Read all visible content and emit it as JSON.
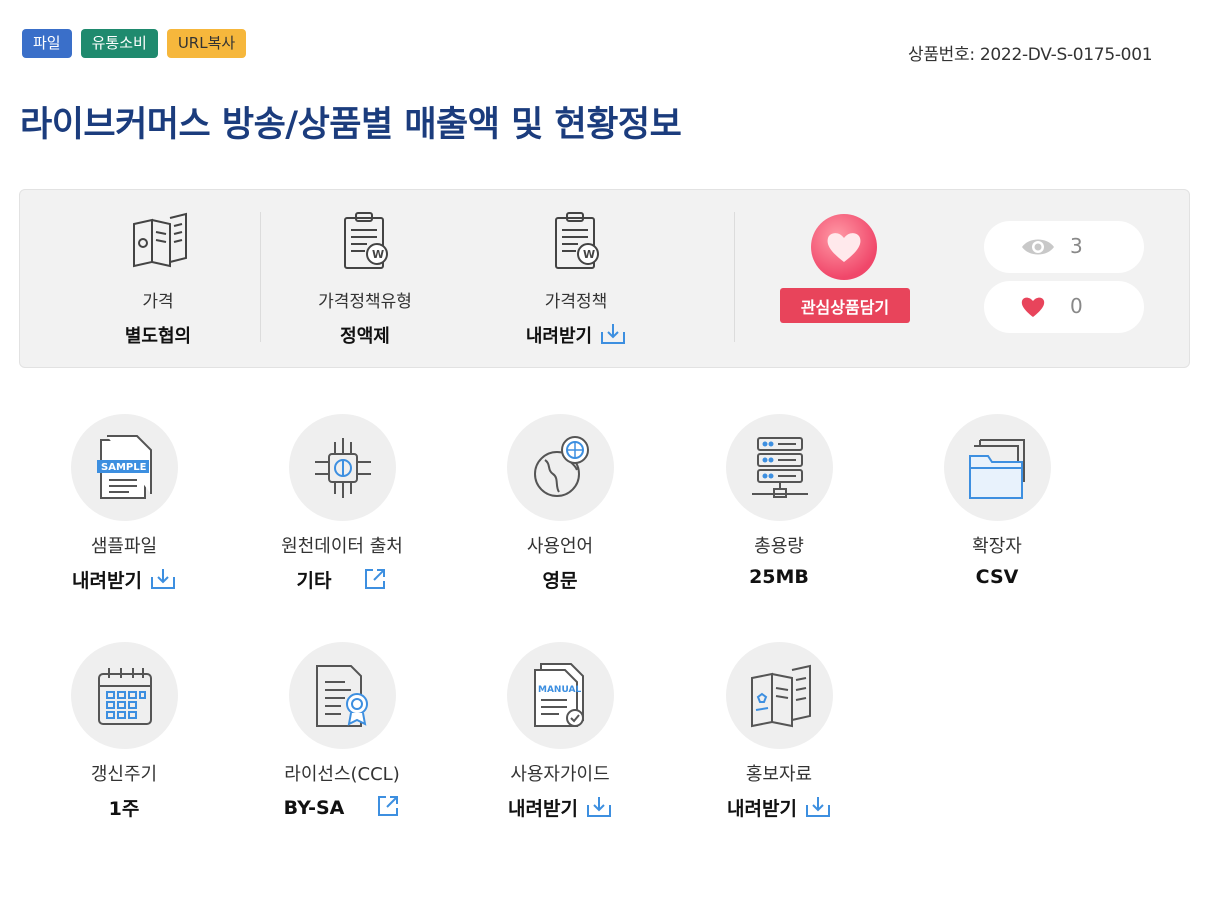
{
  "tags": {
    "file": "파일",
    "category": "유통소비",
    "url_copy": "URL복사"
  },
  "product_number": "상품번호: 2022-DV-S-0175-001",
  "title": "라이브커머스 방송/상품별 매출액 및 현황정보",
  "summary": {
    "price": {
      "label": "가격",
      "value": "별도협의"
    },
    "policy_type": {
      "label": "가격정책유형",
      "value": "정액제"
    },
    "policy": {
      "label": "가격정책",
      "value": "내려받기"
    },
    "like_button": "관심상품담기",
    "views": "3",
    "likes": "0"
  },
  "info": {
    "sample": {
      "label": "샘플파일",
      "value": "내려받기"
    },
    "source": {
      "label": "원천데이터 출처",
      "value": "기타"
    },
    "language": {
      "label": "사용언어",
      "value": "영문"
    },
    "size": {
      "label": "총용량",
      "value": "25MB"
    },
    "ext": {
      "label": "확장자",
      "value": "CSV"
    },
    "cycle": {
      "label": "갱신주기",
      "value": "1주"
    },
    "license": {
      "label": "라이선스(CCL)",
      "value": "BY-SA"
    },
    "guide": {
      "label": "사용자가이드",
      "value": "내려받기"
    },
    "promo": {
      "label": "홍보자료",
      "value": "내려받기"
    }
  },
  "colors": {
    "title": "#1b3c7d",
    "tag_file": "#3a6fc9",
    "tag_category": "#1f8a6e",
    "tag_url": "#f6b73c",
    "like_button": "#e8445b",
    "accent_icon": "#3d8fe0"
  }
}
